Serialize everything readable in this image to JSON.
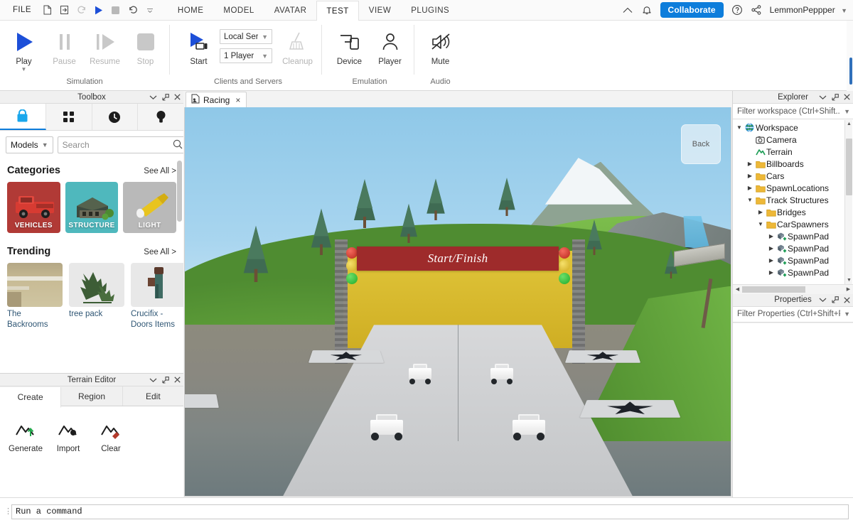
{
  "menubar": {
    "file_label": "FILE",
    "quick_icons": [
      {
        "name": "new-file-icon",
        "title": "New"
      },
      {
        "name": "open-file-icon",
        "title": "Open"
      },
      {
        "name": "redo-icon",
        "title": "Redo"
      },
      {
        "name": "play-icon",
        "title": "Play"
      },
      {
        "name": "stop-icon",
        "title": "Stop"
      },
      {
        "name": "undo-icon",
        "title": "Undo"
      },
      {
        "name": "chevron-down-icon",
        "title": "Customize"
      }
    ],
    "tabs": [
      {
        "label": "HOME",
        "active": false
      },
      {
        "label": "MODEL",
        "active": false
      },
      {
        "label": "AVATAR",
        "active": false
      },
      {
        "label": "TEST",
        "active": true
      },
      {
        "label": "VIEW",
        "active": false
      },
      {
        "label": "PLUGINS",
        "active": false
      }
    ],
    "collaborate_label": "Collaborate",
    "username": "LemmonPeppper",
    "accent_blue": "#0d7ddb"
  },
  "ribbon": {
    "groups": [
      {
        "title": "Simulation",
        "buttons": [
          {
            "label": "Play",
            "icon": "play-icon",
            "enabled": true,
            "has_caret": true
          },
          {
            "label": "Pause",
            "icon": "pause-icon",
            "enabled": false,
            "has_caret": false
          },
          {
            "label": "Resume",
            "icon": "resume-icon",
            "enabled": false,
            "has_caret": false
          },
          {
            "label": "Stop",
            "icon": "stop-icon",
            "enabled": false,
            "has_caret": false
          }
        ]
      },
      {
        "title": "Clients and Servers",
        "buttons": [
          {
            "label": "Start",
            "icon": "start-server-icon",
            "enabled": true,
            "has_caret": false
          },
          {
            "label": "Cleanup",
            "icon": "cleanup-broom-icon",
            "enabled": false,
            "has_caret": false
          }
        ],
        "dropdowns": [
          {
            "name": "server-type-select",
            "value": "Local Server"
          },
          {
            "name": "player-count-select",
            "value": "1 Player"
          }
        ]
      },
      {
        "title": "Emulation",
        "buttons": [
          {
            "label": "Device",
            "icon": "device-icon",
            "enabled": true,
            "has_caret": false
          },
          {
            "label": "Player",
            "icon": "player-person-icon",
            "enabled": true,
            "has_caret": false
          }
        ]
      },
      {
        "title": "Audio",
        "buttons": [
          {
            "label": "Mute",
            "icon": "mute-speaker-icon",
            "enabled": true,
            "has_caret": false
          }
        ]
      }
    ]
  },
  "toolbox": {
    "title": "Toolbox",
    "tabs": [
      {
        "name": "tab-inventory",
        "icon": "lock-bag-icon",
        "active": true
      },
      {
        "name": "tab-marketplace",
        "icon": "grid-squares-icon",
        "active": false
      },
      {
        "name": "tab-recent",
        "icon": "clock-icon",
        "active": false
      },
      {
        "name": "tab-creations",
        "icon": "lightbulb-icon",
        "active": false
      }
    ],
    "asset_type": "Models",
    "search_placeholder": "Search",
    "search_value": "",
    "sections": [
      {
        "title": "Categories",
        "see_all": "See All >",
        "items": [
          {
            "label": "VEHICLES",
            "bg": "#b13a36",
            "label_color": "#ffffff"
          },
          {
            "label": "STRUCTURE",
            "bg": "#4fb8bd",
            "label_color": "#ffffff"
          },
          {
            "label": "LIGHT",
            "bg": "#b9b9b9",
            "label_color": "#ffffff"
          }
        ]
      },
      {
        "title": "Trending",
        "see_all": "See All >",
        "items": [
          {
            "label": "The Backrooms"
          },
          {
            "label": "tree pack"
          },
          {
            "label": "Crucifix - Doors Items"
          }
        ]
      }
    ]
  },
  "terrain_editor": {
    "title": "Terrain Editor",
    "tabs": [
      {
        "label": "Create",
        "active": true
      },
      {
        "label": "Region",
        "active": false
      },
      {
        "label": "Edit",
        "active": false
      }
    ],
    "buttons": [
      {
        "label": "Generate",
        "icon": "terrain-generate-icon"
      },
      {
        "label": "Import",
        "icon": "terrain-import-icon"
      },
      {
        "label": "Clear",
        "icon": "terrain-clear-icon"
      }
    ]
  },
  "viewport": {
    "tab_label": "Racing",
    "tab_icon": "place-file-icon",
    "tab_close": "×",
    "view_cube_label": "Back",
    "banner_text": "Start/Finish"
  },
  "explorer": {
    "title": "Explorer",
    "filter_placeholder": "Filter workspace (Ctrl+Shift...",
    "nodes": [
      {
        "label": "Workspace",
        "depth": 0,
        "icon": "workspace-globe-icon",
        "twisty": "down"
      },
      {
        "label": "Camera",
        "depth": 1,
        "icon": "camera-icon",
        "twisty": "none"
      },
      {
        "label": "Terrain",
        "depth": 1,
        "icon": "terrain-icon",
        "twisty": "none"
      },
      {
        "label": "Billboards",
        "depth": 1,
        "icon": "folder-icon",
        "twisty": "right"
      },
      {
        "label": "Cars",
        "depth": 1,
        "icon": "folder-icon",
        "twisty": "right"
      },
      {
        "label": "SpawnLocations",
        "depth": 1,
        "icon": "folder-icon",
        "twisty": "right"
      },
      {
        "label": "Track Structures",
        "depth": 1,
        "icon": "folder-icon",
        "twisty": "down"
      },
      {
        "label": "Bridges",
        "depth": 2,
        "icon": "folder-icon",
        "twisty": "right"
      },
      {
        "label": "CarSpawners",
        "depth": 2,
        "icon": "folder-icon",
        "twisty": "down"
      },
      {
        "label": "SpawnPad",
        "depth": 3,
        "icon": "spawn-pad-icon",
        "twisty": "right"
      },
      {
        "label": "SpawnPad",
        "depth": 3,
        "icon": "spawn-pad-icon",
        "twisty": "right"
      },
      {
        "label": "SpawnPad",
        "depth": 3,
        "icon": "spawn-pad-icon",
        "twisty": "right"
      },
      {
        "label": "SpawnPad",
        "depth": 3,
        "icon": "spawn-pad-icon",
        "twisty": "right"
      }
    ]
  },
  "properties": {
    "title": "Properties",
    "filter_placeholder": "Filter Properties (Ctrl+Shift+P)"
  },
  "command_bar": {
    "placeholder": "Run a command",
    "value": ""
  },
  "panel_controls": {
    "collapse": "collapse-chevron-icon",
    "popout": "popout-icon",
    "close": "close-icon"
  }
}
